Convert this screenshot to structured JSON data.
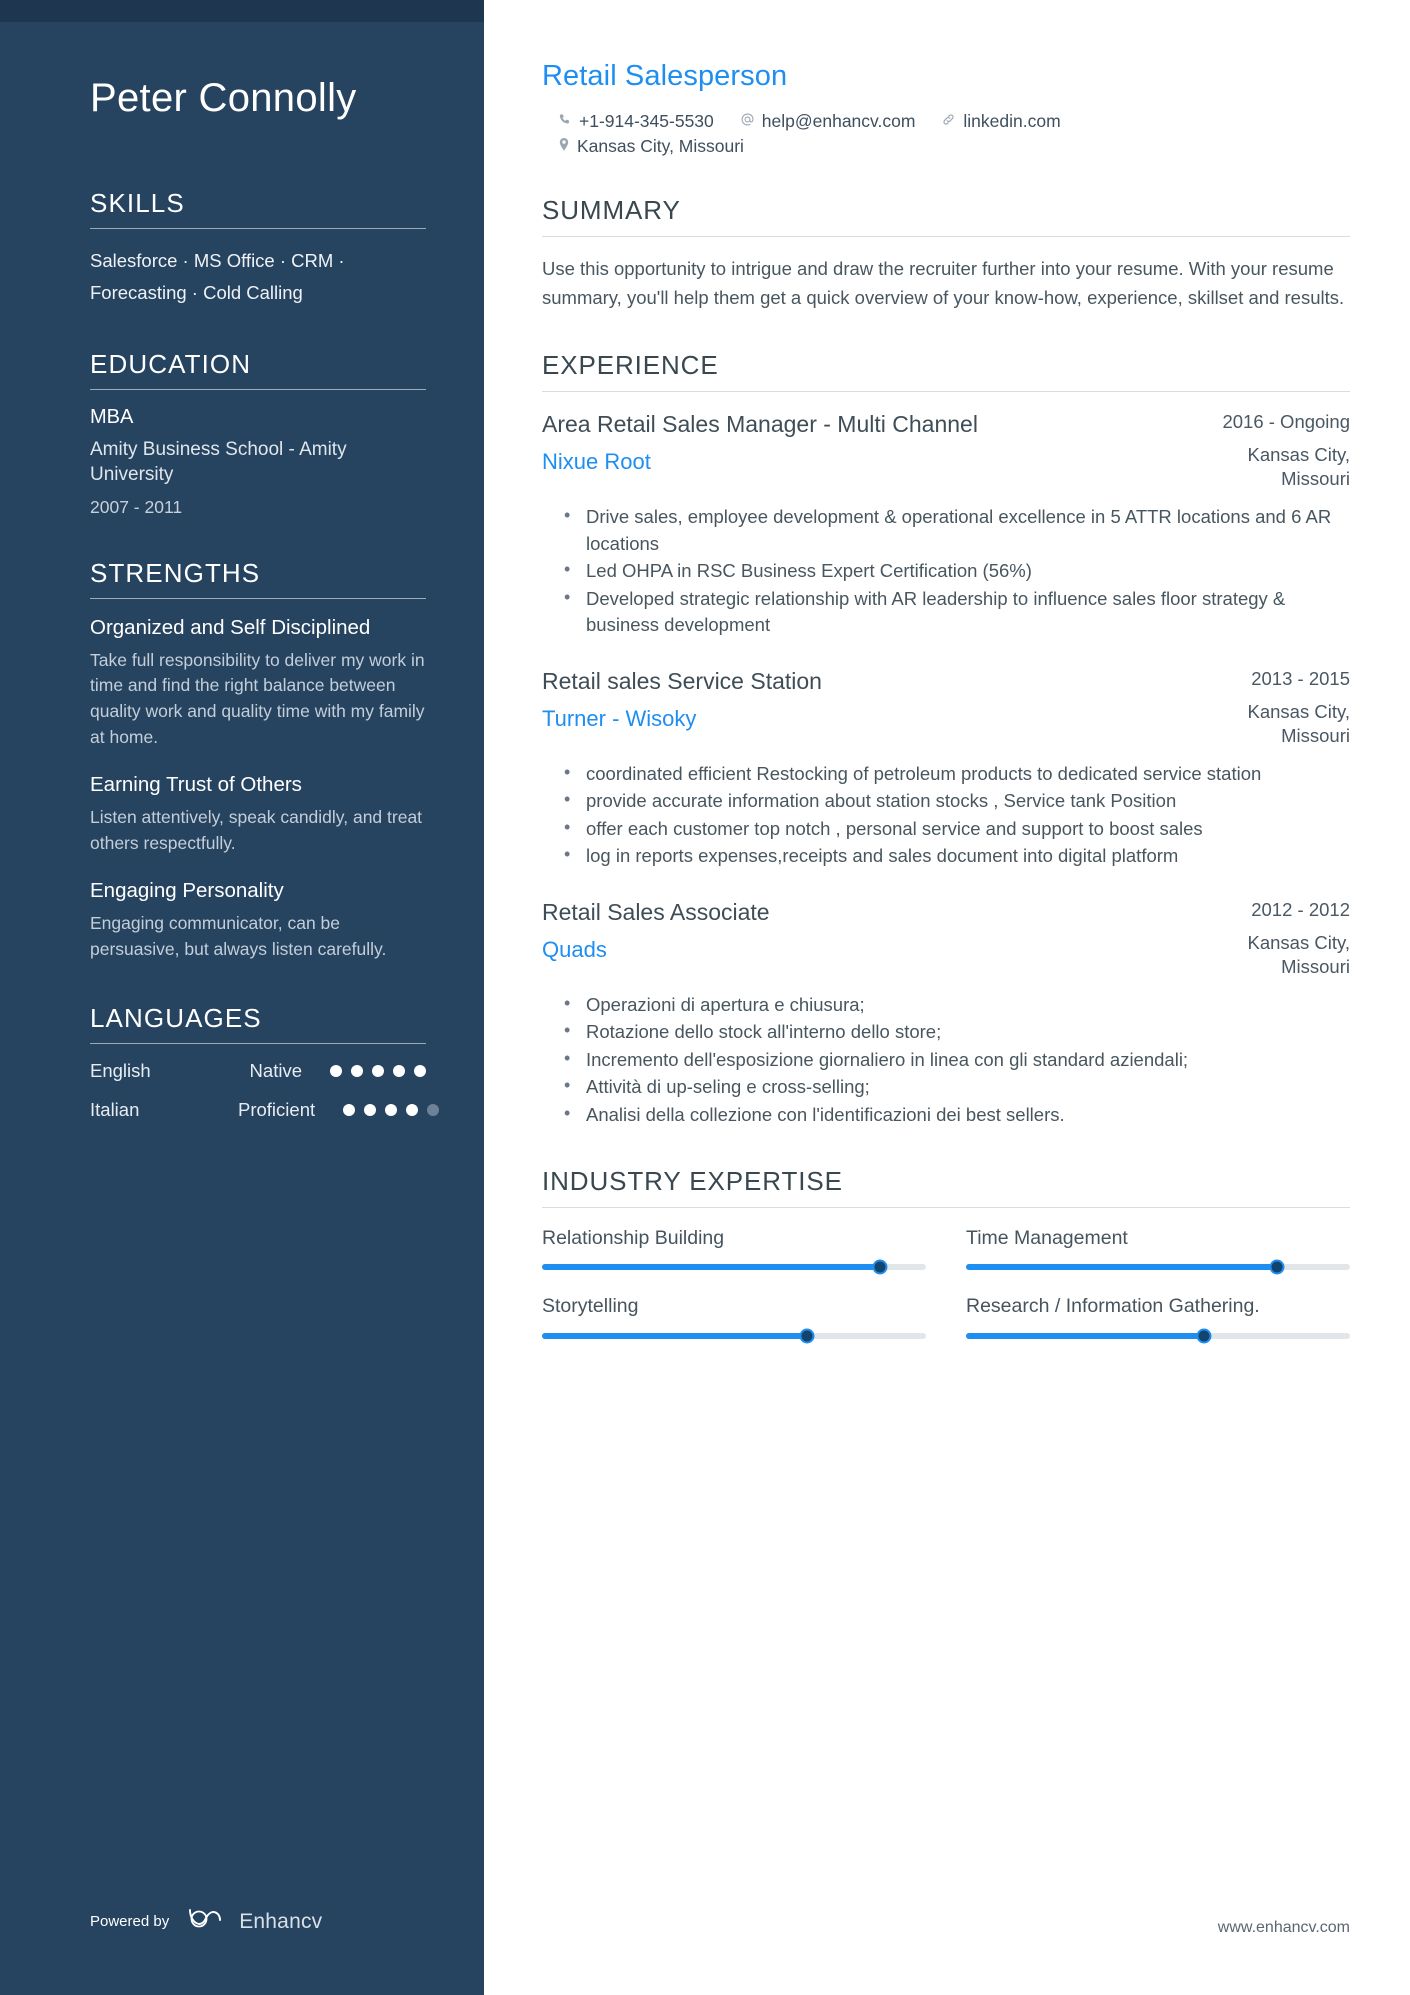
{
  "candidate": {
    "name": "Peter Connolly",
    "headline": "Retail Salesperson"
  },
  "contact": {
    "phone": "+1-914-345-5530",
    "email": "help@enhancv.com",
    "linkedin": "linkedin.com",
    "location": "Kansas City, Missouri",
    "phone_icon": "phone-icon",
    "email_icon": "at-icon",
    "link_icon": "link-icon",
    "location_icon": "map-pin-icon"
  },
  "sidebar": {
    "skills": {
      "heading": "SKILLS",
      "text": "Salesforce · MS Office · CRM · Forecasting · Cold Calling"
    },
    "education": {
      "heading": "EDUCATION",
      "items": [
        {
          "degree": "MBA",
          "school": "Amity Business School - Amity University",
          "dates": "2007 - 2011"
        }
      ]
    },
    "strengths": {
      "heading": "STRENGTHS",
      "items": [
        {
          "title": "Organized and Self Disciplined",
          "description": "Take full responsibility to deliver my work in time and find the right balance between quality work and quality time with my family at home."
        },
        {
          "title": "Earning Trust of Others",
          "description": "Listen attentively, speak candidly, and treat others respectfully."
        },
        {
          "title": "Engaging Personality",
          "description": "Engaging communicator, can be persuasive, but always listen carefully."
        }
      ]
    },
    "languages": {
      "heading": "LANGUAGES",
      "items": [
        {
          "name": "English",
          "level": "Native",
          "filled": 5,
          "total": 5
        },
        {
          "name": "Italian",
          "level": "Proficient",
          "filled": 4,
          "total": 5
        }
      ]
    },
    "footer": {
      "powered_by": "Powered by",
      "brand": "Enhancv",
      "brand_icon": "enhancv-logo-icon"
    }
  },
  "main": {
    "summary": {
      "heading": "SUMMARY",
      "text": "Use this opportunity to intrigue and draw the recruiter further into your resume. With your resume summary, you'll help them get a quick overview of your know-how, experience, skillset and results."
    },
    "experience": {
      "heading": "EXPERIENCE",
      "entries": [
        {
          "role": "Area Retail Sales Manager - Multi Channel",
          "company": "Nixue Root",
          "dates": "2016 - Ongoing",
          "location": "Kansas City, Missouri",
          "bullets": [
            "Drive sales, employee development & operational excellence in 5 ATTR locations and 6 AR locations",
            "Led OHPA in RSC Business Expert Certification (56%)",
            "Developed strategic relationship with AR leadership to influence sales floor strategy & business development"
          ]
        },
        {
          "role": "Retail sales Service Station",
          "company": "Turner - Wisoky",
          "dates": "2013 - 2015",
          "location": "Kansas City, Missouri",
          "bullets": [
            "coordinated efficient Restocking of petroleum products to dedicated service station",
            "provide accurate information about station stocks , Service tank Position",
            "offer each customer top notch , personal service and support to boost sales",
            "log in reports expenses,receipts and sales document into digital platform"
          ]
        },
        {
          "role": "Retail Sales Associate",
          "company": "Quads",
          "dates": "2012 - 2012",
          "location": "Kansas City, Missouri",
          "bullets": [
            "Operazioni di apertura e chiusura;",
            "Rotazione dello stock all'interno dello store;",
            "Incremento dell'esposizione giornaliero in linea con gli standard aziendali;",
            "Attività di up-seling e cross-selling;",
            "Analisi della collezione con l'identificazioni dei best sellers."
          ]
        }
      ]
    },
    "industry_expertise": {
      "heading": "INDUSTRY EXPERTISE",
      "items": [
        {
          "label": "Relationship Building",
          "value": 88
        },
        {
          "label": "Time Management",
          "value": 81
        },
        {
          "label": "Storytelling",
          "value": 69
        },
        {
          "label": "Research / Information Gathering.",
          "value": 62
        }
      ]
    },
    "footer_url": "www.enhancv.com"
  },
  "colors": {
    "sidebar_bg": "#26435f",
    "accent_blue": "#1f8ef1",
    "text_dark": "#3f4d57"
  }
}
